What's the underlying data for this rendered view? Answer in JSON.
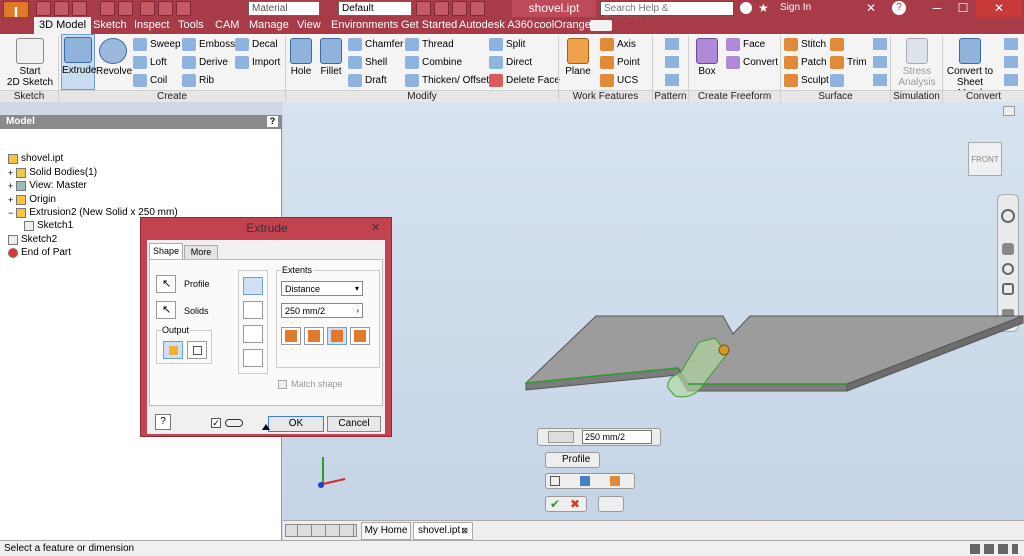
{
  "titlebar": {
    "material": "Material",
    "appearance": "Default",
    "doc_title": "shovel.ipt",
    "search_placeholder": "Search Help & Commands...",
    "sign_in": "Sign In"
  },
  "tabs": [
    "3D Model",
    "Sketch",
    "Inspect",
    "Tools",
    "CAM",
    "Manage",
    "View",
    "Environments",
    "Get Started",
    "Autodesk A360",
    "coolOrange"
  ],
  "ribbon": {
    "start_sketch": "Start\n2D Sketch",
    "extrude": "Extrude",
    "revolve": "Revolve",
    "sweep": "Sweep",
    "emboss": "Emboss",
    "decal": "Decal",
    "loft": "Loft",
    "derive": "Derive",
    "import": "Import",
    "coil": "Coil",
    "rib": "Rib",
    "hole": "Hole",
    "fillet": "Fillet",
    "chamfer": "Chamfer",
    "thread": "Thread",
    "shell": "Shell",
    "combine": "Combine",
    "draft": "Draft",
    "thicken": "Thicken/ Offset",
    "split": "Split",
    "direct": "Direct",
    "delete_face": "Delete Face",
    "plane": "Plane",
    "axis": "Axis",
    "point": "Point",
    "ucs": "UCS",
    "box": "Box",
    "face": "Face",
    "convert": "Convert",
    "stitch": "Stitch",
    "patch": "Patch",
    "sculpt": "Sculpt",
    "trim": "Trim",
    "stress": "Stress\nAnalysis",
    "convert_sheet": "Convert to\nSheet Metal",
    "panels": [
      "Sketch",
      "Create",
      "Modify",
      "Work Features",
      "Pattern",
      "Create Freeform",
      "Surface",
      "Simulation",
      "Convert"
    ]
  },
  "browser": {
    "title": "Model",
    "items": [
      "shovel.ipt",
      "Solid Bodies(1)",
      "View: Master",
      "Origin",
      "Extrusion2 (New Solid x 250 mm)",
      "Sketch1",
      "Sketch2",
      "End of Part"
    ]
  },
  "dialog": {
    "title": "Extrude",
    "tab_shape": "Shape",
    "tab_more": "More",
    "profile": "Profile",
    "solids": "Solids",
    "output": "Output",
    "extents": "Extents",
    "extent_type": "Distance",
    "distance": "250 mm/2",
    "match_shape": "Match shape",
    "ok": "OK",
    "cancel": "Cancel"
  },
  "viewcube": "FRONT",
  "minitoolbar": {
    "distance": "250 mm/2",
    "profile": "Profile"
  },
  "doctabs": {
    "home": "My Home",
    "file": "shovel.ipt"
  },
  "status": "Select a feature or dimension"
}
